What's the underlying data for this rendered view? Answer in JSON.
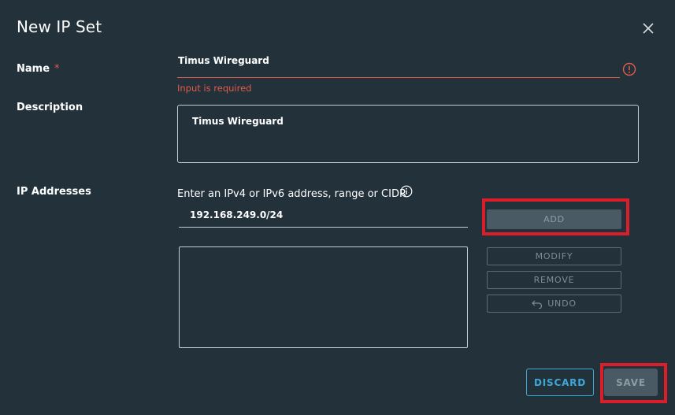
{
  "dialog": {
    "title": "New IP Set",
    "close_icon": "close-icon"
  },
  "name": {
    "label": "Name",
    "required_mark": "*",
    "value": "Timus Wireguard",
    "error": "Input is required",
    "error_icon": "alert-circle-icon",
    "error_color": "#e25a4b"
  },
  "description": {
    "label": "Description",
    "value": "Timus Wireguard"
  },
  "ip_addresses": {
    "label": "IP Addresses",
    "help_text": "Enter an IPv4 or IPv6 address, range or CIDR",
    "info_icon": "info-icon",
    "input_value": "192.168.249.0/24",
    "items": []
  },
  "buttons": {
    "add": "ADD",
    "modify": "MODIFY",
    "remove": "REMOVE",
    "undo": "UNDO",
    "undo_icon": "undo-icon",
    "discard": "DISCARD",
    "save": "SAVE"
  },
  "colors": {
    "background": "#23313b",
    "accent": "#3fa7d6",
    "highlight": "#dc1e2a"
  }
}
